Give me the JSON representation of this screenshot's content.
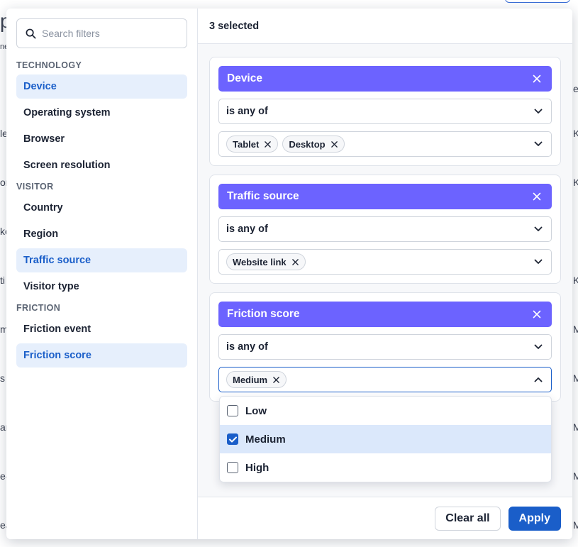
{
  "background": {
    "left_fragments": [
      "p",
      "ne",
      "le",
      "or",
      "ke",
      "ti",
      "m",
      "s",
      "ar",
      "e-",
      "ea"
    ],
    "right_fragments": [
      "e",
      "K",
      "K",
      "K",
      "M",
      "M",
      "M",
      "M",
      "K",
      "M"
    ]
  },
  "search": {
    "placeholder": "Search filters",
    "icon": "search-icon"
  },
  "sidebar": {
    "groups": [
      {
        "title": "TECHNOLOGY",
        "items": [
          {
            "label": "Device",
            "active": true
          },
          {
            "label": "Operating system",
            "active": false
          },
          {
            "label": "Browser",
            "active": false
          },
          {
            "label": "Screen resolution",
            "active": false
          }
        ]
      },
      {
        "title": "VISITOR",
        "items": [
          {
            "label": "Country",
            "active": false
          },
          {
            "label": "Region",
            "active": false
          },
          {
            "label": "Traffic source",
            "active": true
          },
          {
            "label": "Visitor type",
            "active": false
          }
        ]
      },
      {
        "title": "FRICTION",
        "items": [
          {
            "label": "Friction event",
            "active": false
          },
          {
            "label": "Friction score",
            "active": true
          }
        ]
      }
    ]
  },
  "main": {
    "selected_count": "3 selected",
    "filters": [
      {
        "title": "Device",
        "operator": "is any of",
        "chips": [
          "Tablet",
          "Desktop"
        ]
      },
      {
        "title": "Traffic source",
        "operator": "is any of",
        "chips": [
          "Website link"
        ]
      },
      {
        "title": "Friction score",
        "operator": "is any of",
        "chips": [
          "Medium"
        ]
      }
    ],
    "dropdown_options": [
      {
        "label": "Low",
        "checked": false
      },
      {
        "label": "Medium",
        "checked": true
      },
      {
        "label": "High",
        "checked": false
      }
    ]
  },
  "footer": {
    "clear_label": "Clear all",
    "apply_label": "Apply"
  },
  "colors": {
    "accent": "#6c63ff",
    "primary": "#1a5ec9",
    "active_bg": "#e6effc",
    "selected_option_bg": "#dbe8fb"
  }
}
